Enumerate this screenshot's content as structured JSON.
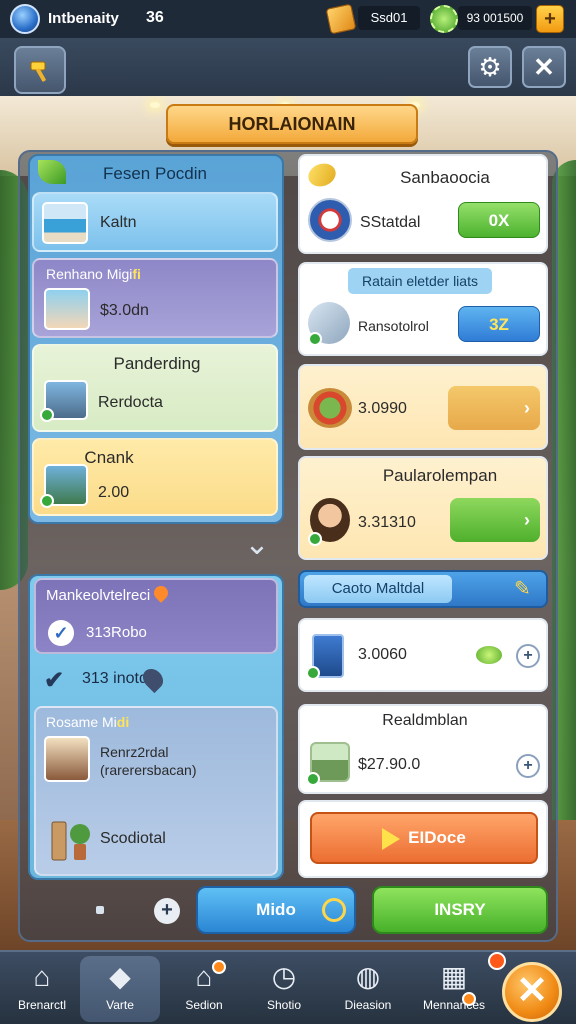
{
  "topbar": {
    "player_name": "Intbenaity",
    "level": "36",
    "currency_1": "Ssd01",
    "currency_2": "93 001500",
    "add_label": "+"
  },
  "header": {
    "title": "HORLAIONAIN"
  },
  "left_panel": {
    "title": "Fesen Pocdin",
    "cards": [
      {
        "title": "",
        "value": "Kaltn"
      },
      {
        "title": "Renhano Migi",
        "title_highlight": "fi",
        "value": "$3.0dn"
      },
      {
        "title": "Panderding",
        "value": "Rerdocta"
      },
      {
        "title": "Cnank",
        "value": "2.00"
      }
    ]
  },
  "lower_left": {
    "card1_title": "Mankeolvtelreci",
    "card1_value": "313Robo",
    "mid_value": "313 inotd",
    "card2_title": "Rosame Mi",
    "card2_title_highlight": "di",
    "card2_line1": "Renrz2rdal",
    "card2_line2": "(rarerersbacan)",
    "card2_value": "Scodiotal"
  },
  "right_panel": {
    "card1": {
      "title": "Sanbaoocia",
      "value": "SStatdal",
      "button": "0X"
    },
    "card2": {
      "tag": "Ratain eletder liats",
      "value": "Ransotolrol",
      "button": "3Z"
    },
    "card3": {
      "value": "3.0990",
      "button": "›"
    },
    "card4": {
      "title": "Paularolempan",
      "value": "3.31310",
      "button": "›"
    },
    "section_label": "Caoto Maltdal",
    "card5": {
      "value": "3.0060",
      "add": "+"
    },
    "card6": {
      "title": "Realdmblan",
      "value": "$27.90.0",
      "add": "+"
    },
    "card7": {
      "button": "EIDoce"
    }
  },
  "actions": {
    "plus": "+",
    "mido_label": "Mido",
    "insry_label": "INSRY"
  },
  "bottom_nav": {
    "items": [
      {
        "label": "Brenarctl",
        "icon": "home-icon"
      },
      {
        "label": "Varte",
        "icon": "dice-icon"
      },
      {
        "label": "Sedion",
        "icon": "build-icon"
      },
      {
        "label": "Shotio",
        "icon": "clock-icon"
      },
      {
        "label": "Dieasion",
        "icon": "chat-icon"
      },
      {
        "label": "Mennances",
        "icon": "grid-icon"
      }
    ],
    "close_label": "✕"
  }
}
